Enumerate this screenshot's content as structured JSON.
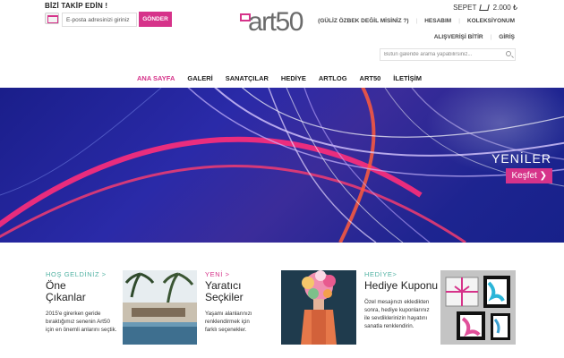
{
  "header": {
    "follow_title": "BİZİ TAKİP EDİN !",
    "email_placeholder": "E-posta adresinizi giriniz",
    "send_label": "GÖNDER",
    "logo_text": "art50",
    "cart_label": "SEPET",
    "cart_total": "2.000 ₺",
    "user_links_row1": [
      "(GÜLİZ ÖZBEK DEĞİL MİSİNİZ ?)",
      "HESABIM",
      "KOLEKSİYONUM"
    ],
    "user_links_row2": [
      "ALIŞVERİŞİ BİTİR",
      "GİRİŞ"
    ],
    "search_placeholder": "Bütün galeride arama yapabilirsiniz..."
  },
  "nav": {
    "items": [
      "ANA SAYFA",
      "GALERİ",
      "SANATÇILAR",
      "HEDİYE",
      "ARTLOG",
      "ART50",
      "İLETİŞİM"
    ],
    "active_index": 0
  },
  "hero": {
    "title": "YENİLER",
    "button_label": "Keşfet"
  },
  "cards": [
    {
      "tag": "HOŞ GELDİNİZ >",
      "title_line1": "Öne",
      "title_line2": "Çıkanlar",
      "body": [
        "2015'e girerken geride",
        "bıraktığımız senenin Art50",
        "için en önemli anlarını seçtik."
      ]
    },
    {
      "tag": "YENİ >",
      "title_line1": "Yaratıcı",
      "title_line2": "Seçkiler",
      "body": [
        "Yaşamı alanlarınızı",
        "renklendirmek için",
        "farklı seçenekler."
      ]
    },
    {
      "tag": "HEDİYE>",
      "title_line1": "Hediye Kuponu",
      "title_line2": "",
      "body": [
        "Özel mesajınızı ekledikten",
        "sonra, hediye kuponlarınız",
        "ile sevdiklerinizin hayatını",
        "sanatla renklendirin."
      ]
    }
  ],
  "colors": {
    "accent": "#d6338a",
    "teal": "#52b2a3"
  }
}
